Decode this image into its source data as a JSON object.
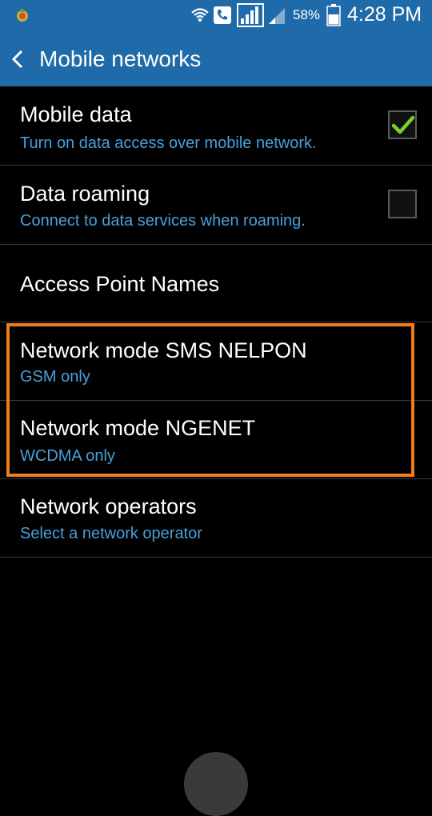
{
  "status_bar": {
    "battery_percent": "58%",
    "time": "4:28 PM",
    "icons": [
      "app-notification-icon",
      "wifi-icon",
      "call-icon",
      "signal-icon",
      "signal-secondary-icon",
      "battery-icon"
    ]
  },
  "action_bar": {
    "title": "Mobile networks",
    "back_icon": "chevron-left-icon"
  },
  "settings": [
    {
      "title": "Mobile data",
      "subtitle": "Turn on data access over mobile network.",
      "checked": true
    },
    {
      "title": "Data roaming",
      "subtitle": "Connect to data services when roaming.",
      "checked": false
    },
    {
      "title": "Access Point Names"
    },
    {
      "title": "Network mode SMS NELPON",
      "subtitle": "GSM only"
    },
    {
      "title": "Network mode NGENET",
      "subtitle": "WCDMA only"
    },
    {
      "title": "Network operators",
      "subtitle": "Select a network operator"
    }
  ],
  "colors": {
    "bar": "#1f6aa8",
    "subtitle": "#4a9fdc",
    "highlight": "#f07c1e",
    "check": "#7bd02a"
  }
}
